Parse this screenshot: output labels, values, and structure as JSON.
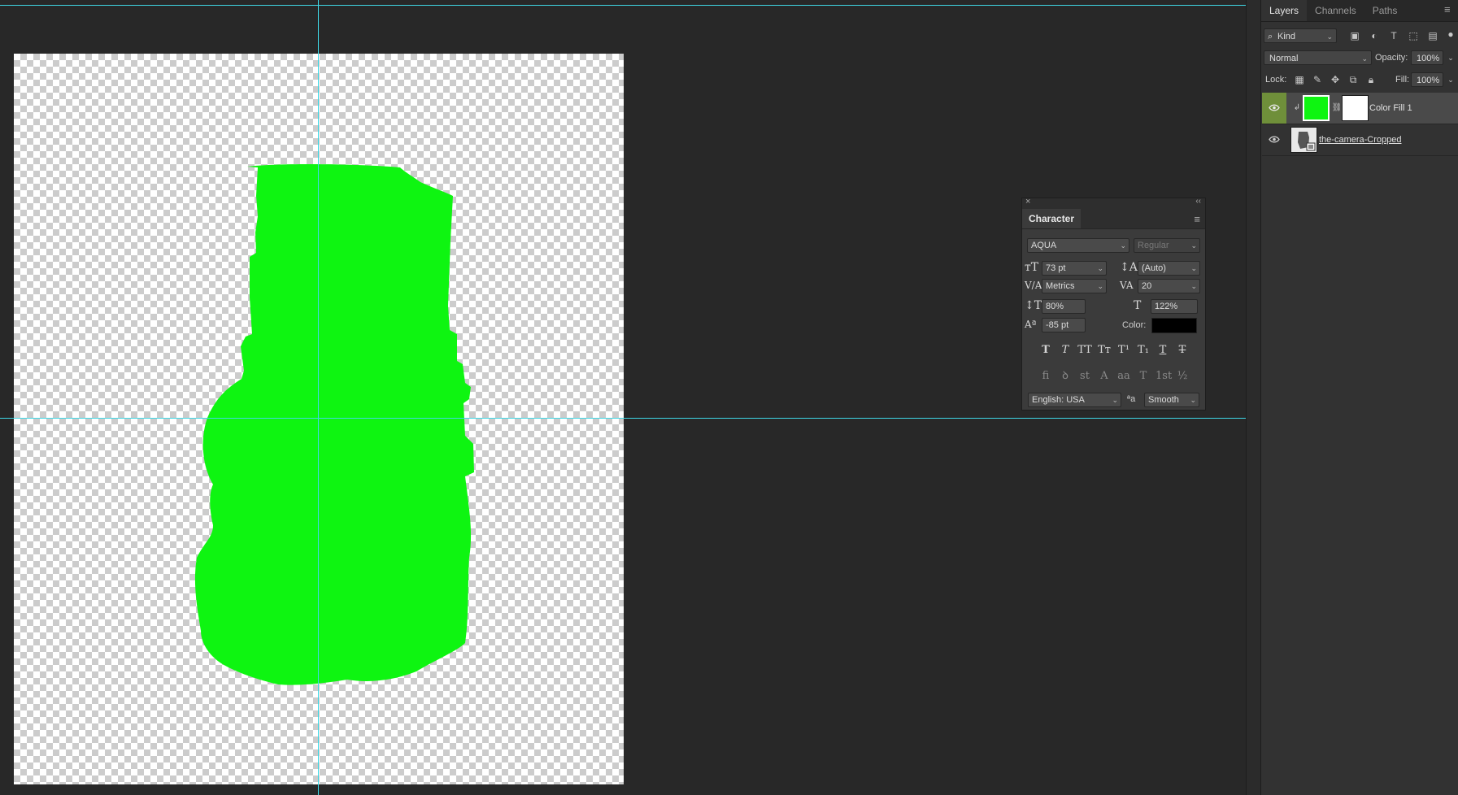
{
  "colors": {
    "fill_green": "#0ef511",
    "guide": "#3fd8e6",
    "selected_eye": "#6f8f3a"
  },
  "layers_panel": {
    "tabs": [
      {
        "label": "Layers",
        "active": true
      },
      {
        "label": "Channels",
        "active": false
      },
      {
        "label": "Paths",
        "active": false
      }
    ],
    "filter_kind": "Kind",
    "blend_mode": "Normal",
    "opacity_label": "Opacity:",
    "opacity_value": "100%",
    "lock_label": "Lock:",
    "fill_label": "Fill:",
    "fill_value": "100%",
    "layers": [
      {
        "name": "Color Fill 1",
        "selected": true,
        "visible": true
      },
      {
        "name": "the-camera-Cropped",
        "selected": false,
        "visible": true
      }
    ]
  },
  "character_panel": {
    "title": "Character",
    "font_family": "AQUA",
    "font_style": "Regular",
    "font_size": "73 pt",
    "leading": "(Auto)",
    "kerning": "Metrics",
    "tracking": "20",
    "vertical_scale": "80%",
    "horizontal_scale": "122%",
    "baseline_shift": "-85 pt",
    "color_label": "Color:",
    "text_color": "#000000",
    "style_buttons": [
      "T",
      "T",
      "TT",
      "Tт",
      "T¹",
      "T₁",
      "T",
      "T"
    ],
    "opentype_buttons": [
      "fi",
      "ꝺ",
      "st",
      "A",
      "aa",
      "T",
      "1st",
      "½"
    ],
    "language": "English: USA",
    "aa_label": "ªa",
    "antialias": "Smooth"
  }
}
